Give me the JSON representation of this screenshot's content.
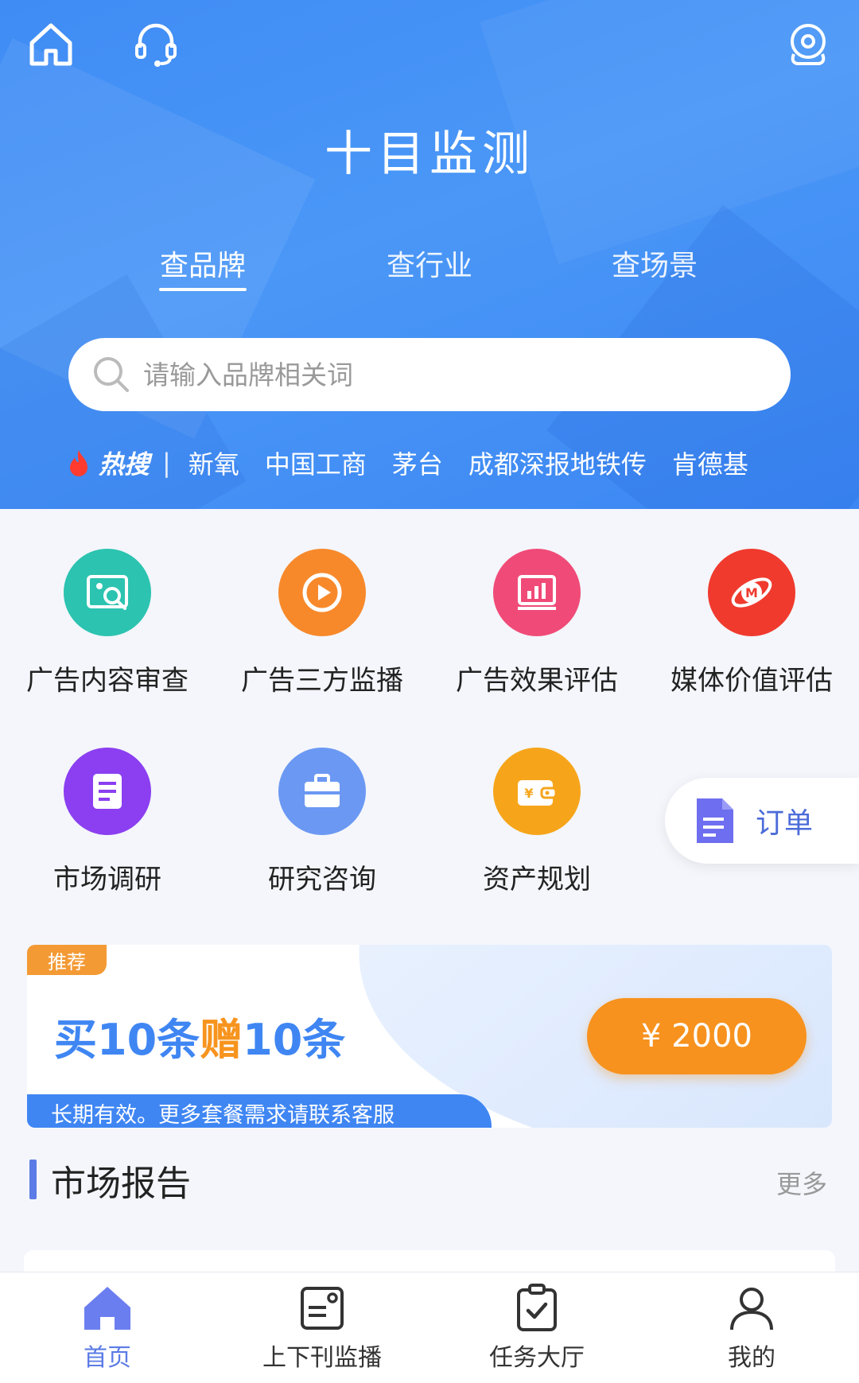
{
  "header": {
    "title": "十目监测",
    "tabs": [
      {
        "label": "查品牌",
        "active": true
      },
      {
        "label": "查行业",
        "active": false
      },
      {
        "label": "查场景",
        "active": false
      }
    ],
    "search": {
      "placeholder": "请输入品牌相关词"
    },
    "hot": {
      "label": "热搜",
      "separator": "|",
      "keywords": [
        "新氧",
        "中国工商",
        "茅台",
        "成都深报地铁传",
        "肯德基"
      ]
    }
  },
  "services": [
    {
      "label": "广告内容审查",
      "icon": "image-search-icon",
      "color": "#2cc3b0"
    },
    {
      "label": "广告三方监播",
      "icon": "play-icon",
      "color": "#f7892b"
    },
    {
      "label": "广告效果评估",
      "icon": "bar-chart-icon",
      "color": "#f04b78"
    },
    {
      "label": "媒体价值评估",
      "icon": "media-m-icon",
      "color": "#f03a2e"
    },
    {
      "label": "市场调研",
      "icon": "document-icon",
      "color": "#8b3ff0"
    },
    {
      "label": "研究咨询",
      "icon": "briefcase-icon",
      "color": "#6b98f3"
    },
    {
      "label": "资产规划",
      "icon": "wallet-icon",
      "color": "#f6a51b"
    }
  ],
  "order_fab": {
    "label": "订单",
    "icon": "order-doc-icon"
  },
  "promo": {
    "badge": "推荐",
    "headline_buy": "买10条",
    "headline_gift": "赠",
    "headline_rest": "10条",
    "price": "¥ 2000",
    "note": "长期有效。更多套餐需求请联系客服"
  },
  "section": {
    "title": "市场报告",
    "more": "更多"
  },
  "bottom_nav": [
    {
      "label": "首页",
      "icon": "home-icon",
      "active": true
    },
    {
      "label": "上下刊监播",
      "icon": "monitor-card-icon",
      "active": false
    },
    {
      "label": "任务大厅",
      "icon": "task-clipboard-icon",
      "active": false
    },
    {
      "label": "我的",
      "icon": "user-icon",
      "active": false
    }
  ],
  "colors": {
    "primary": "#4a97f7",
    "accent": "#f7921e",
    "nav_active": "#5b7be6"
  }
}
